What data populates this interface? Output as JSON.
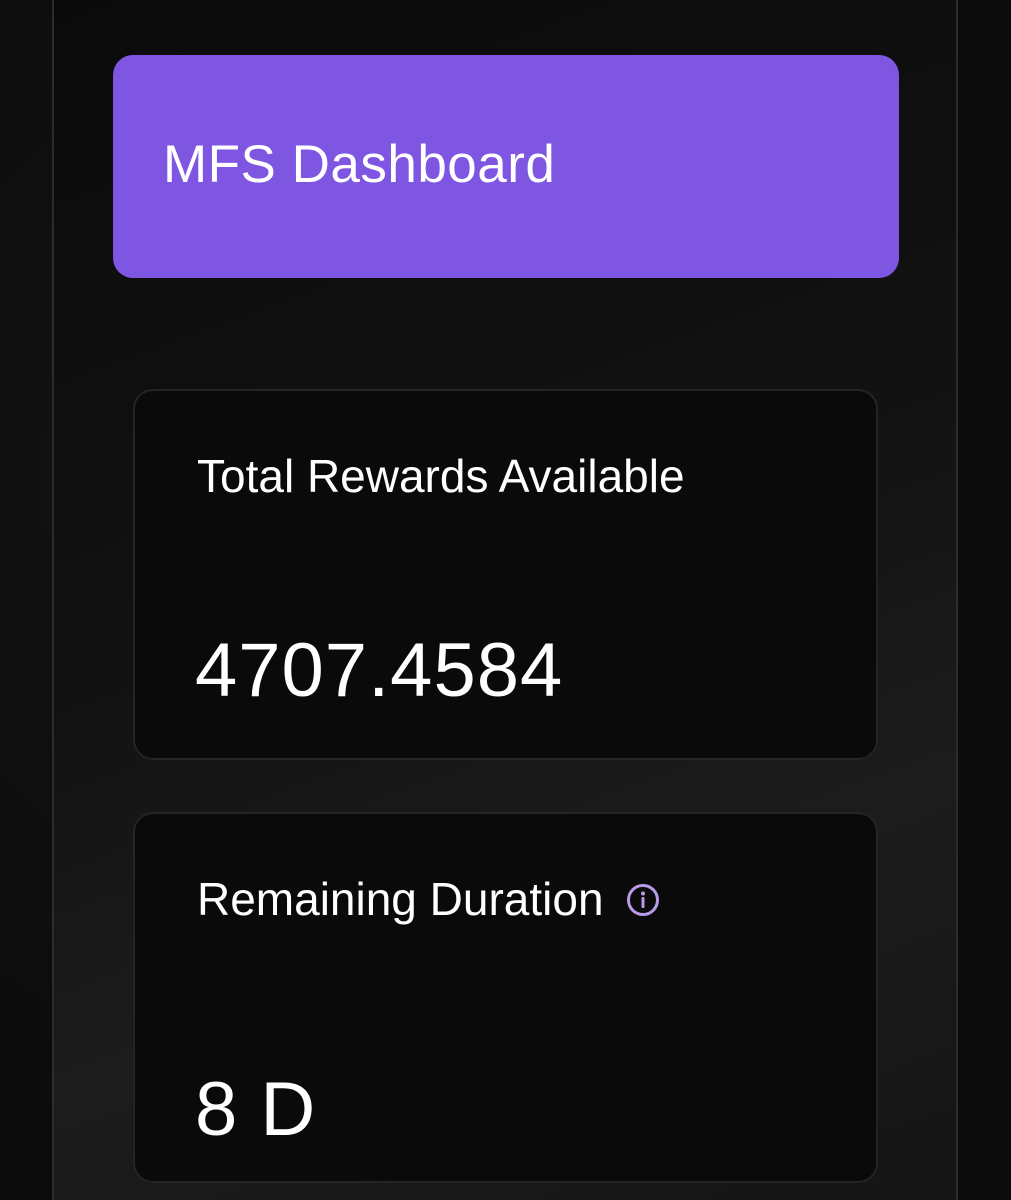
{
  "header": {
    "title": "MFS Dashboard"
  },
  "rewards_card": {
    "label": "Total Rewards Available",
    "value": "4707.4584"
  },
  "duration_card": {
    "label": "Remaining Duration",
    "value": "8 D",
    "info_icon": "info-icon"
  },
  "colors": {
    "accent": "#7f56e2",
    "info_icon": "#b79be8",
    "background": "#0e0e0e",
    "card": "#0a0a0a"
  }
}
